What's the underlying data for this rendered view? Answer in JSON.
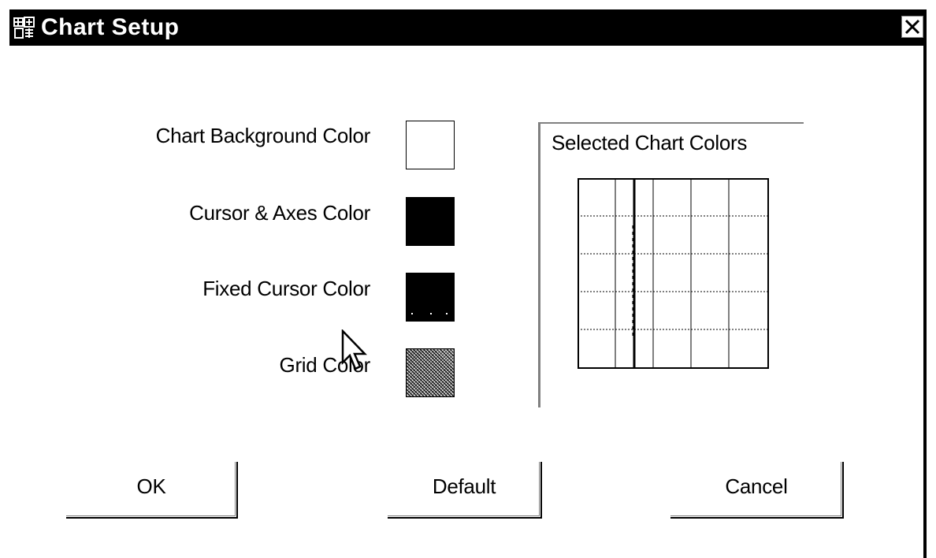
{
  "window": {
    "title": "Chart Setup",
    "app_icon": "chart-setup-app-icon",
    "close_icon": "close-icon"
  },
  "settings": {
    "background": {
      "label": "Chart Background Color",
      "color": "#ffffff"
    },
    "axes": {
      "label": "Cursor & Axes Color",
      "color": "#000000"
    },
    "fixed_cursor": {
      "label": "Fixed Cursor Color",
      "color": "#000000"
    },
    "grid": {
      "label": "Grid Color",
      "color": "#808080"
    }
  },
  "preview": {
    "title": "Selected Chart Colors"
  },
  "buttons": {
    "ok": "OK",
    "default": "Default",
    "cancel": "Cancel"
  }
}
